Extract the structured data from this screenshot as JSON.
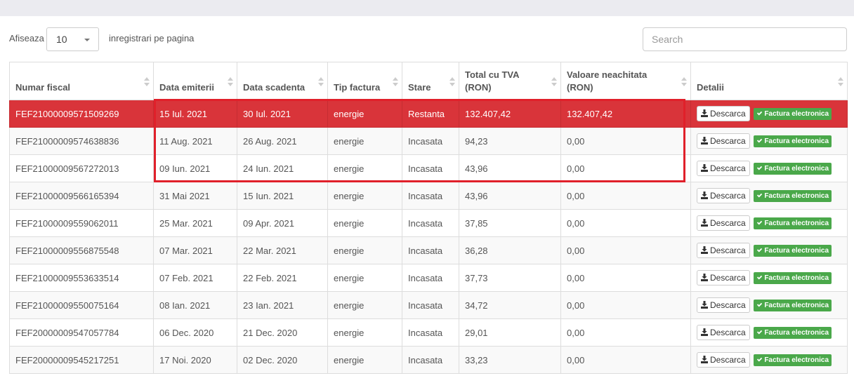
{
  "length_menu": {
    "prefix": "Afiseaza",
    "selected": "10",
    "suffix": "inregistrari pe pagina"
  },
  "search": {
    "placeholder": "Search"
  },
  "table": {
    "headers": {
      "numar_fiscal": "Numar fiscal",
      "data_emiterii": "Data emiterii",
      "data_scadenta": "Data scadenta",
      "tip_factura": "Tip factura",
      "stare": "Stare",
      "total_tva": "Total cu TVA (RON)",
      "valoare_neachitata": "Valoare neachitata (RON)",
      "detalii": "Detalii"
    },
    "download_label": "Descarca",
    "einvoice_label": "Factura electronica",
    "rows": [
      {
        "numar": "FEF21000009571509269",
        "emitere": "15 Iul. 2021",
        "scadenta": "30 Iul. 2021",
        "tip": "energie",
        "stare": "Restanta",
        "total": "132.407,42",
        "neachitat": "132.407,42",
        "overdue": true
      },
      {
        "numar": "FEF21000009574638836",
        "emitere": "11 Aug. 2021",
        "scadenta": "26 Aug. 2021",
        "tip": "energie",
        "stare": "Incasata",
        "total": "94,23",
        "neachitat": "0,00"
      },
      {
        "numar": "FEF21000009567272013",
        "emitere": "09 Iun. 2021",
        "scadenta": "24 Iun. 2021",
        "tip": "energie",
        "stare": "Incasata",
        "total": "43,96",
        "neachitat": "0,00"
      },
      {
        "numar": "FEF21000009566165394",
        "emitere": "31 Mai 2021",
        "scadenta": "15 Iun. 2021",
        "tip": "energie",
        "stare": "Incasata",
        "total": "43,96",
        "neachitat": "0,00"
      },
      {
        "numar": "FEF21000009559062011",
        "emitere": "25 Mar. 2021",
        "scadenta": "09 Apr. 2021",
        "tip": "energie",
        "stare": "Incasata",
        "total": "37,85",
        "neachitat": "0,00"
      },
      {
        "numar": "FEF21000009556875548",
        "emitere": "07 Mar. 2021",
        "scadenta": "22 Mar. 2021",
        "tip": "energie",
        "stare": "Incasata",
        "total": "36,28",
        "neachitat": "0,00"
      },
      {
        "numar": "FEF21000009553633514",
        "emitere": "07 Feb. 2021",
        "scadenta": "22 Feb. 2021",
        "tip": "energie",
        "stare": "Incasata",
        "total": "37,73",
        "neachitat": "0,00"
      },
      {
        "numar": "FEF21000009550075164",
        "emitere": "08 Ian. 2021",
        "scadenta": "23 Ian. 2021",
        "tip": "energie",
        "stare": "Incasata",
        "total": "34,72",
        "neachitat": "0,00"
      },
      {
        "numar": "FEF20000009547057784",
        "emitere": "06 Dec. 2020",
        "scadenta": "21 Dec. 2020",
        "tip": "energie",
        "stare": "Incasata",
        "total": "29,01",
        "neachitat": "0,00"
      },
      {
        "numar": "FEF20000009545217251",
        "emitere": "17 Noi. 2020",
        "scadenta": "02 Dec. 2020",
        "tip": "energie",
        "stare": "Incasata",
        "total": "33,23",
        "neachitat": "0,00"
      }
    ]
  },
  "colors": {
    "overdue_row": "#d9343a",
    "badge_green": "#4aa84a",
    "highlight_border": "#e0202a"
  },
  "icons": {
    "download": "download-icon",
    "check": "check-icon",
    "caret": "chevron-down-icon",
    "sort": "sort-icon"
  }
}
